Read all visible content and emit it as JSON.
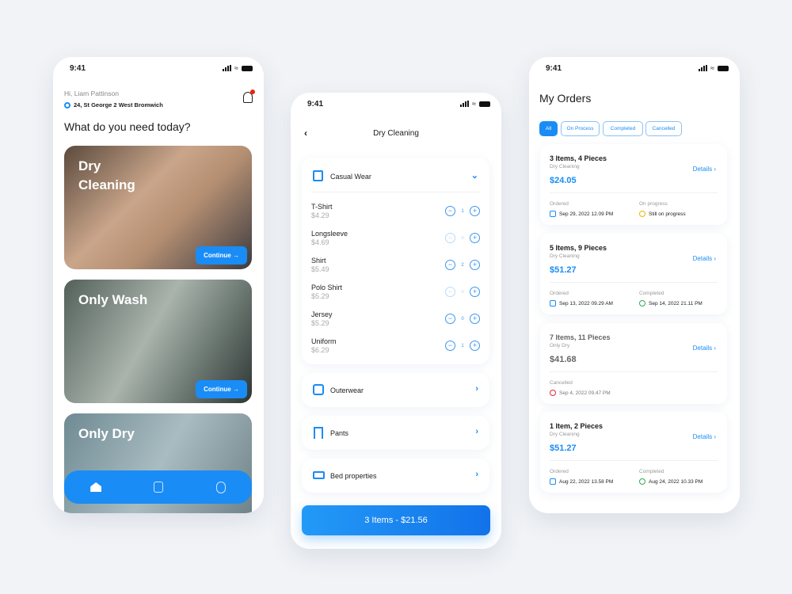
{
  "status_time": "9:41",
  "home": {
    "greeting": "Hi, Liam Pattinson",
    "address": "24, St George 2 West Bromwich",
    "question": "What do you need today?",
    "services": [
      {
        "title": "Dry Cleaning",
        "button": "Continue"
      },
      {
        "title": "Only Wash",
        "button": "Continue"
      },
      {
        "title": "Only Dry"
      }
    ],
    "nav": [
      "home-icon",
      "orders-icon",
      "profile-icon"
    ],
    "accent": "#1a8cf5"
  },
  "dry_cleaning": {
    "title": "Dry Cleaning",
    "casual": {
      "label": "Casual Wear",
      "items": [
        {
          "name": "T-Shirt",
          "price": "$4.29",
          "qty": "1"
        },
        {
          "name": "Longsleeve",
          "price": "$4.69",
          "qty": "0"
        },
        {
          "name": "Shirt",
          "price": "$5.49",
          "qty": "2"
        },
        {
          "name": "Polo Shirt",
          "price": "$5.29",
          "qty": "0"
        },
        {
          "name": "Jersey",
          "price": "$5.29",
          "qty": "0"
        },
        {
          "name": "Uniform",
          "price": "$6.29",
          "qty": "1"
        }
      ]
    },
    "categories": [
      "Outerwear",
      "Pants",
      "Bed properties"
    ],
    "checkout": "3 Items - $21.56"
  },
  "orders": {
    "title": "My Orders",
    "filters": [
      "All",
      "On Process",
      "Completed",
      "Cancelled"
    ],
    "details_label": "Details",
    "list": [
      {
        "title": "3 Items, 4 Pieces",
        "service": "Dry Cleaning",
        "price": "$24.05",
        "l1": "Ordered",
        "v1": "Sep 29, 2022  12.09 PM",
        "l2": "On progress",
        "v2": "Still on progress",
        "status": "progress"
      },
      {
        "title": "5 Items, 9 Pieces",
        "service": "Dry Cleaning",
        "price": "$51.27",
        "l1": "Ordered",
        "v1": "Sep 13, 2022  09.29 AM",
        "l2": "Completed",
        "v2": "Sep 14, 2022  21.11 PM",
        "status": "completed"
      },
      {
        "title": "7 Items, 11 Pieces",
        "service": "Only Dry",
        "price": "$41.68",
        "l1": "Cancelled",
        "v1": "Sep 4, 2022  09.47 PM",
        "status": "cancelled"
      },
      {
        "title": "1 Item, 2 Pieces",
        "service": "Dry Cleaning",
        "price": "$51.27",
        "l1": "Ordered",
        "v1": "Aug 22, 2022  13.58 PM",
        "l2": "Completed",
        "v2": "Aug 24, 2022  10.33 PM",
        "status": "completed"
      }
    ]
  }
}
